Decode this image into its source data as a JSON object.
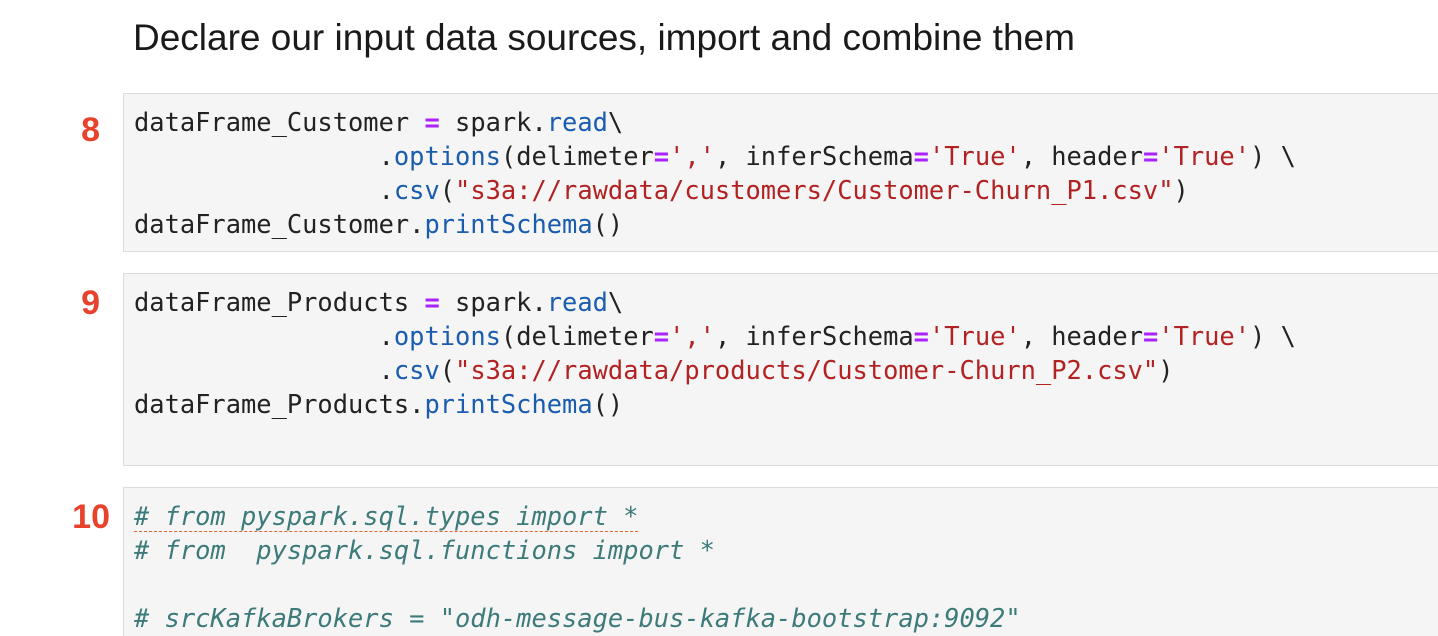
{
  "heading": "Declare our input data sources, import and combine them",
  "cells": [
    {
      "number": "8",
      "lines": [
        [
          "dataFrame_Customer ",
          "=",
          " spark.",
          "read",
          "\\"
        ],
        [
          "                ",
          ".",
          "options",
          "(delimeter",
          "=",
          "','",
          ", inferSchema",
          "=",
          "'True'",
          ", header",
          "=",
          "'True'",
          ") \\"
        ],
        [
          "                ",
          ".",
          "csv",
          "(",
          "\"s3a://rawdata/customers/Customer-Churn_P1.csv\"",
          ")"
        ],
        [
          "dataFrame_Customer.",
          "printSchema",
          "()"
        ]
      ]
    },
    {
      "number": "9",
      "lines": [
        [
          "dataFrame_Products ",
          "=",
          " spark.",
          "read",
          "\\"
        ],
        [
          "                ",
          ".",
          "options",
          "(delimeter",
          "=",
          "','",
          ", inferSchema",
          "=",
          "'True'",
          ", header",
          "=",
          "'True'",
          ") \\"
        ],
        [
          "                ",
          ".",
          "csv",
          "(",
          "\"s3a://rawdata/products/Customer-Churn_P2.csv\"",
          ")"
        ],
        [
          "dataFrame_Products.",
          "printSchema",
          "()"
        ]
      ]
    },
    {
      "number": "10",
      "lines": [
        [
          "# from pyspark.sql.types import *"
        ],
        [
          "# from  pyspark.sql.functions import *"
        ],
        [
          ""
        ],
        [
          "# srcKafkaBrokers = \"odh-message-bus-kafka-bootstrap:9092\""
        ]
      ]
    }
  ],
  "colors": {
    "cell_number": "#e8412c",
    "operator": "#aa22ff",
    "attribute": "#1a5cae",
    "string": "#b22222",
    "comment": "#3d7a7a",
    "cell_background": "#f5f5f5"
  }
}
